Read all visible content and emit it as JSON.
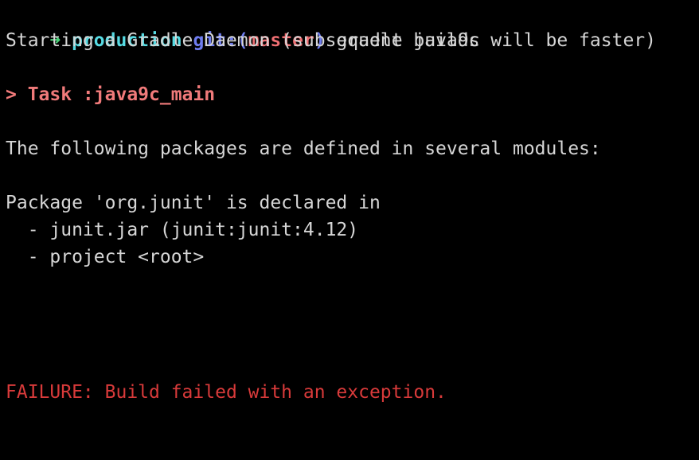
{
  "prompt": {
    "arrow": "➜",
    "directory": "production",
    "git_prefix": "git:(",
    "branch": "master",
    "git_suffix": ")",
    "command": "gradle java9c"
  },
  "output": {
    "daemon_line": "Starting a Gradle Daemon (subsequent builds will be faster)",
    "task_line": "> Task :java9c_main",
    "packages_line": "The following packages are defined in several modules:",
    "package_declared_line": "Package 'org.junit' is declared in",
    "module_1": "  - junit.jar (junit:junit:4.12)",
    "module_2": "  - project <root>",
    "failure_line": "FAILURE: Build failed with an exception."
  },
  "colors": {
    "background": "#000000",
    "text": "#d6d6d6",
    "arrow": "#4bd27a",
    "directory": "#57dbe3",
    "git": "#6f7df0",
    "branch": "#ef6f73",
    "task": "#f07a7a",
    "failure": "#d83a3a"
  }
}
